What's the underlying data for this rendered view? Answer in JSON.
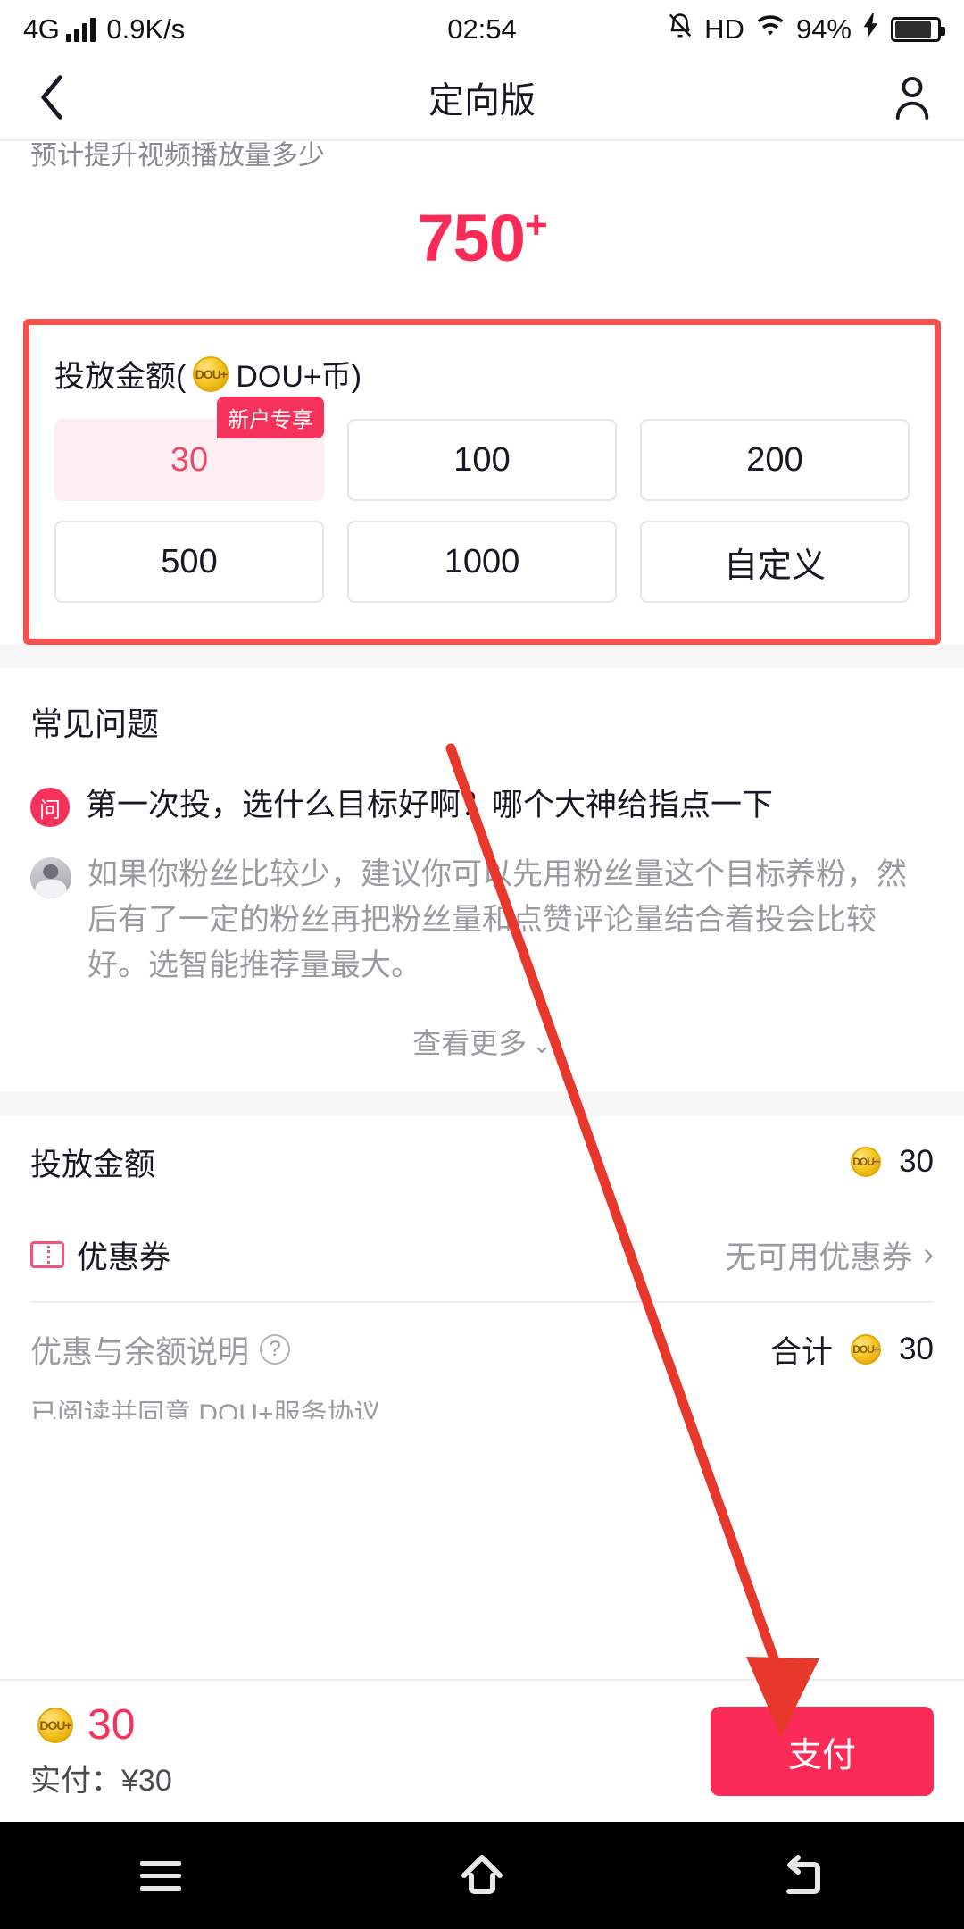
{
  "status_bar": {
    "network": "4G",
    "speed": "0.9K/s",
    "time": "02:54",
    "hd": "HD",
    "battery_percent": "94%",
    "icons": [
      "signal-bars-icon",
      "mute-bell-icon",
      "hd-icon",
      "wifi-icon",
      "charging-bolt-icon",
      "battery-icon"
    ]
  },
  "header": {
    "title": "定向版",
    "back_icon": "chevron-left-icon",
    "profile_icon": "person-icon"
  },
  "hero": {
    "clipped_text": "预计提升视频播放量多少",
    "estimate_value": "750",
    "estimate_suffix": "+"
  },
  "amount_section": {
    "label_prefix": "投放金额(",
    "coin_icon_text": "DOU+",
    "label_suffix": "DOU+币)",
    "badge_label": "新户专享",
    "options": [
      {
        "label": "30",
        "selected": true,
        "badge": "新户专享"
      },
      {
        "label": "100",
        "selected": false
      },
      {
        "label": "200",
        "selected": false
      },
      {
        "label": "500",
        "selected": false
      },
      {
        "label": "1000",
        "selected": false
      },
      {
        "label": "自定义",
        "selected": false
      }
    ]
  },
  "faq": {
    "title": "常见问题",
    "question_icon_label": "问",
    "question": "第一次投，选什么目标好啊？哪个大神给指点一下",
    "answer": "如果你粉丝比较少，建议你可以先用粉丝量这个目标养粉，然后有了一定的粉丝再把粉丝量和点赞评论量结合着投会比较好。选智能推荐量最大。",
    "more_label": "查看更多",
    "more_icon": "chevron-down-icon"
  },
  "order": {
    "amount_row_label": "投放金额",
    "amount_row_value": "30",
    "coupon_row_label": "优惠券",
    "coupon_row_value": "无可用优惠券",
    "coupon_icon": "ticket-icon",
    "coupon_chevron": "chevron-right-icon",
    "balance_note_label": "优惠与余额说明",
    "balance_help_icon": "question-mark-icon",
    "total_label": "合计",
    "total_value": "30",
    "agreement_clipped": "已阅读并同意 DOU+服务协议"
  },
  "pay_bar": {
    "coin_amount": "30",
    "actual_label": "实付：¥30",
    "pay_button": "支付"
  },
  "android_nav": {
    "recents_icon": "menu-icon",
    "home_icon": "home-icon",
    "back_icon": "back-arrow-icon"
  },
  "annotation": {
    "highlight_color": "#F5524F",
    "arrow_color": "#E8382C",
    "arrow_target": "pay-button"
  },
  "colors": {
    "brand_pink": "#FA2B56",
    "badge_red": "#F5325B",
    "selected_bg": "#FDEFF1",
    "muted_text": "#9a9a9f"
  }
}
